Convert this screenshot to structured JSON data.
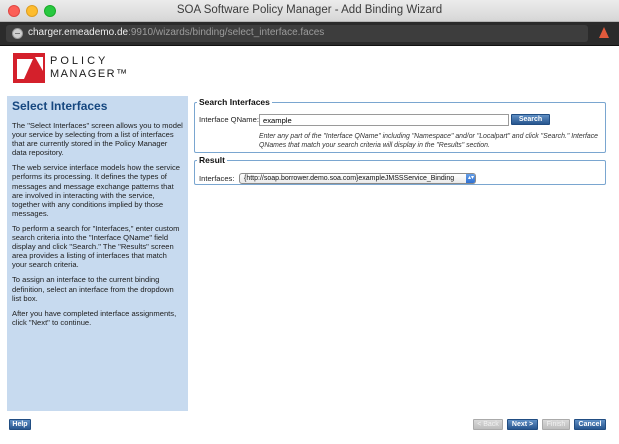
{
  "window": {
    "title": "SOA Software Policy Manager - Add Binding Wizard",
    "url_host": "charger.emeademo.de",
    "url_path": ":9910/wizards/binding/select_interface.faces"
  },
  "logo": {
    "line1": "POLICY",
    "line2": "MANAGER™",
    "brand_color": "#d4202b"
  },
  "sidebar": {
    "title": "Select Interfaces",
    "paragraphs": [
      "The \"Select Interfaces\" screen allows you to model your service by selecting from a list of interfaces that are currently stored in the Policy Manager data repository.",
      "The web service interface models how the service performs its processing. It defines the types of messages and message exchange patterns that are involved in interacting with the service, together with any conditions implied by those messages.",
      "To perform a search for \"Interfaces,\" enter custom search criteria into the \"Interface QName\" field display and click \"Search.\" The \"Results\" screen area provides a listing of interfaces that match your search criteria.",
      "To assign an interface to the current binding definition, select an interface from the dropdown list box.",
      "After you have completed interface assignments, click \"Next\" to continue."
    ]
  },
  "search": {
    "legend": "Search Interfaces",
    "qname_label": "Interface QName:",
    "qname_value": "example",
    "search_button": "Search",
    "hint": "Enter any part of the \"Interface QName\" including \"Namespace\" and/or \"Localpart\" and click \"Search.\" Interface QNames that match your search criteria will display in the \"Results\" section."
  },
  "result": {
    "legend": "Result",
    "interfaces_label": "Interfaces:",
    "selected_interface": "{http://soap.borrower.demo.soa.com}exampleJMSSService_Binding"
  },
  "footer": {
    "help": "Help",
    "back": "< Back",
    "next": "Next >",
    "finish": "Finish",
    "cancel": "Cancel"
  },
  "colors": {
    "sidebar_bg": "#c7daef",
    "heading_blue": "#16477f",
    "button_blue": "#28568f",
    "panel_border": "#7aa6d0"
  }
}
